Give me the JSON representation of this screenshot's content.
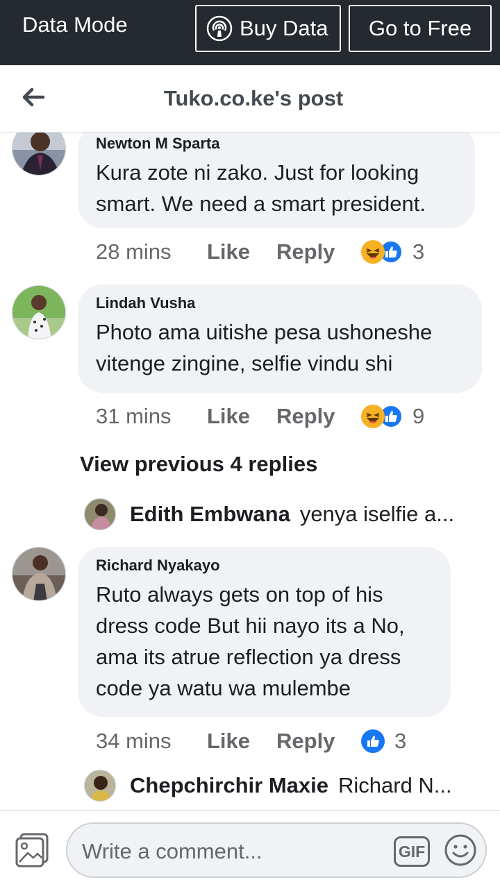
{
  "topbar": {
    "mode_label": "Data Mode",
    "buy_label": "Buy Data",
    "free_label": "Go to Free"
  },
  "header": {
    "title": "Tuko.co.ke's post"
  },
  "comments": [
    {
      "name": "Newton M Sparta",
      "lines": [
        "Kura zote ni zako. Just for looking",
        "smart. We need a smart president."
      ],
      "time": "28 mins",
      "like": "Like",
      "reply": "Reply",
      "reactions": [
        "haha",
        "like"
      ],
      "reaction_count": "3"
    },
    {
      "name": "Lindah Vusha",
      "lines": [
        "Photo ama uitishe pesa ushoneshe",
        "vitenge zingine, selfie vindu shi"
      ],
      "time": "31 mins",
      "like": "Like",
      "reply": "Reply",
      "reactions": [
        "haha",
        "like"
      ],
      "reaction_count": "9",
      "view_previous": "View previous 4 replies",
      "reply_preview": {
        "name": "Edith Embwana",
        "text": "yenya iselfie a..."
      }
    },
    {
      "name": "Richard Nyakayo",
      "lines": [
        "Ruto always gets on top of his",
        "dress code But hii nayo its a No,",
        "ama its atrue reflection ya dress",
        "code ya watu wa mulembe"
      ],
      "time": "34 mins",
      "like": "Like",
      "reply": "Reply",
      "reactions": [
        "like"
      ],
      "reaction_count": "3",
      "reply_preview": {
        "name": "Chepchirchir Maxie",
        "text": "Richard N..."
      }
    }
  ],
  "composer": {
    "placeholder": "Write a comment...",
    "gif_label": "GIF"
  },
  "colors": {
    "topbar_bg": "#252a31",
    "bubble_bg": "#f0f2f5",
    "like_blue": "#1877f2",
    "haha_yellow": "#f7b125",
    "meta_gray": "#65676b"
  }
}
